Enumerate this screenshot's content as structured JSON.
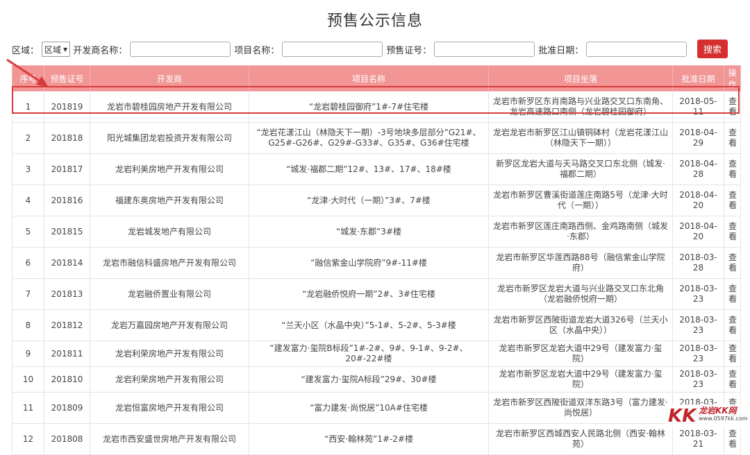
{
  "page": {
    "title": "预售公示信息"
  },
  "filters": {
    "region_label": "区域：",
    "region_value": "区域",
    "developer_label": "开发商名称：",
    "project_label": "项目名称：",
    "permit_label": "预售证号：",
    "date_label": "批准日期：",
    "search_label": "搜索"
  },
  "table": {
    "headers": [
      "序号",
      "预售证号",
      "开发商",
      "项目名称",
      "项目坐落",
      "批准日期",
      "操作"
    ],
    "rows": [
      {
        "no": "1",
        "permit": "201819",
        "dev": "龙岩市碧桂园房地产开发有限公司",
        "project": "“龙岩碧桂园御府”1#-7#住宅楼",
        "location": "龙岩市新罗区东肖南路与兴业路交叉口东南角、龙岩高速路口南侧（龙岩碧桂园御府）",
        "date": "2018-05-11",
        "action": "查看"
      },
      {
        "no": "2",
        "permit": "201818",
        "dev": "阳光城集团龙岩投资开发有限公司",
        "project": "“龙岩花漾江山（林隐天下一期）-3号地块多层部分”G21#、G25#-G26#、G29#-G33#、G35#、G36#住宅楼",
        "location": "龙岩龙岩市新罗区江山镇铜砵村（龙岩花漾江山（林隐天下一期））",
        "date": "2018-04-29",
        "action": "查看"
      },
      {
        "no": "3",
        "permit": "201817",
        "dev": "龙岩利美房地产开发有限公司",
        "project": "“城发·福郡二期”12#、13#、17#、18#楼",
        "location": "新罗区龙岩大道与天马路交叉口东北侧（城发·福郡二期）",
        "date": "2018-04-28",
        "action": "查看"
      },
      {
        "no": "4",
        "permit": "201816",
        "dev": "福建东奥房地产开发有限公司",
        "project": "“龙津·大时代（一期）”3#、7#楼",
        "location": "龙岩市新罗区曹溪街道莲庄南路5号（龙津·大时代（一期））",
        "date": "2018-04-20",
        "action": "查看"
      },
      {
        "no": "5",
        "permit": "201815",
        "dev": "龙岩城发地产有限公司",
        "project": "“城发·东郡”3#楼",
        "location": "龙岩市新罗区莲庄南路西侧、金鸡路南侧（城发·东郡）",
        "date": "2018-04-20",
        "action": "查看"
      },
      {
        "no": "6",
        "permit": "201814",
        "dev": "龙岩市融信科盛房地产开发有限公司",
        "project": "“融信紫金山学院府”9#-11#楼",
        "location": "龙岩市新罗区华莲西路88号（融信紫金山学院府）",
        "date": "2018-03-28",
        "action": "查看"
      },
      {
        "no": "7",
        "permit": "201813",
        "dev": "龙岩融侨置业有限公司",
        "project": "“龙岩融侨悦府一期”2#、3#住宅楼",
        "location": "龙岩市新罗区龙岩大道与兴业路交叉口东北角（龙岩融侨悦府一期）",
        "date": "2018-03-23",
        "action": "查看"
      },
      {
        "no": "8",
        "permit": "201812",
        "dev": "龙岩万嘉园房地产开发有限公司",
        "project": "“兰天小区（水晶中央）”5-1#、5-2#、5-3#楼",
        "location": "龙岩市新罗区西陂街道龙岩大道326号（兰天小区（水晶中央））",
        "date": "2018-03-23",
        "action": "查看"
      },
      {
        "no": "9",
        "permit": "201811",
        "dev": "龙岩利荣房地产开发有限公司",
        "project": "“建发富力·玺院B标段”1#-2#、9#、9-1#、9-2#、20#-22#楼",
        "location": "龙岩市新罗区龙岩大道中29号（建发富力·玺院）",
        "date": "2018-03-23",
        "action": "查看"
      },
      {
        "no": "10",
        "permit": "201810",
        "dev": "龙岩利荣房地产开发有限公司",
        "project": "“建发富力·玺院A标段”29#、30#楼",
        "location": "龙岩市新罗区龙岩大道中29号（建发富力·玺院）",
        "date": "2018-03-23",
        "action": "查看"
      },
      {
        "no": "11",
        "permit": "201809",
        "dev": "龙岩恒富房地产开发有限公司",
        "project": "“富力建发·尚悦居”10A#住宅楼",
        "location": "龙岩市新罗区西陂街道双洋东路3号（富力建发·尚悦居）",
        "date": "2018-03-23",
        "action": "查看"
      },
      {
        "no": "12",
        "permit": "201808",
        "dev": "龙岩市西安盛世房地产开发有限公司",
        "project": "“西安·翰林苑”1#-2#楼",
        "location": "龙岩市新罗区西城西安人民路北侧（西安·翰林苑）",
        "date": "2018-03-21",
        "action": "查看"
      }
    ]
  },
  "watermark": {
    "logo": "KK",
    "text": "龙岩KK网",
    "url": "www.0597kk.com"
  },
  "colors": {
    "header_bg": "#f19595",
    "accent": "#d62f2f",
    "highlight": "#d83b3b"
  }
}
